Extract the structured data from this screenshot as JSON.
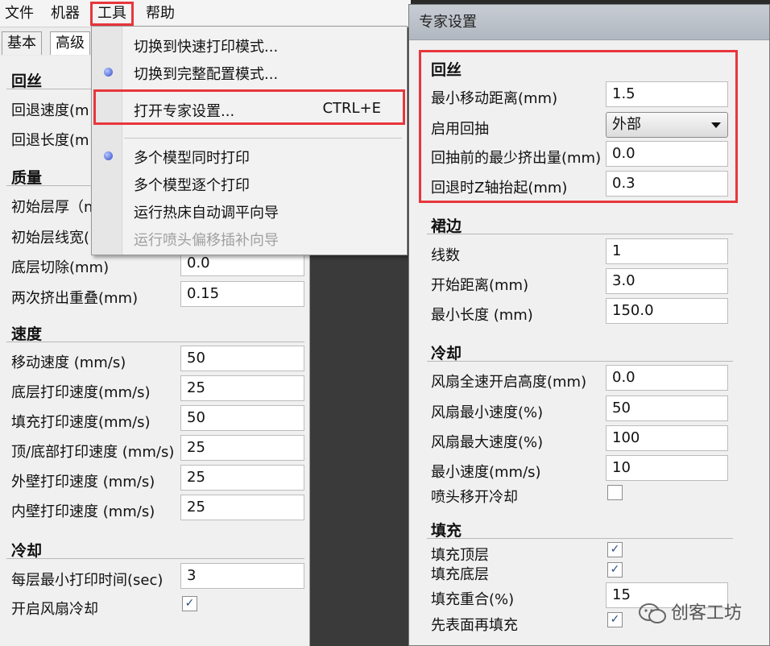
{
  "menubar": {
    "file": "文件",
    "machine": "机器",
    "tools": "工具",
    "help": "帮助"
  },
  "tabs": {
    "basic": "基本",
    "advanced": "高级"
  },
  "left": {
    "retraction": {
      "title": "回丝",
      "speed_label": "回退速度(m",
      "length_label": "回退长度(m"
    },
    "quality": {
      "title": "质量",
      "initial_layer_label": "初始层厚（n",
      "initial_width_label": "初始层线宽(",
      "cut_off_label": "底层切除(mm)",
      "cut_off_value": "0.0",
      "overlap_label": "两次挤出重叠(mm)",
      "overlap_value": "0.15"
    },
    "speed": {
      "title": "速度",
      "rows": [
        {
          "label": "移动速度 (mm/s)",
          "value": "50"
        },
        {
          "label": "底层打印速度(mm/s)",
          "value": "25"
        },
        {
          "label": "填充打印速度(mm/s)",
          "value": "50"
        },
        {
          "label": "顶/底部打印速度 (mm/s)",
          "value": "25"
        },
        {
          "label": "外壁打印速度 (mm/s)",
          "value": "25"
        },
        {
          "label": "内壁打印速度 (mm/s)",
          "value": "25"
        }
      ]
    },
    "cooling": {
      "title": "冷却",
      "min_time_label": "每层最小打印时间(sec)",
      "min_time_value": "3",
      "fan_label": "开启风扇冷却",
      "fan_checked": true
    }
  },
  "dropdown": {
    "quick_mode": "切换到快速打印模式...",
    "full_mode": "切换到完整配置模式...",
    "expert": "打开专家设置...",
    "expert_shortcut": "CTRL+E",
    "multi_same": "多个模型同时打印",
    "multi_one": "多个模型逐个打印",
    "bed_level": "运行热床自动调平向导",
    "nozzle_offset": "运行喷头偏移插补向导"
  },
  "dialog": {
    "title": "专家设置",
    "retraction": {
      "title": "回丝",
      "min_travel_label": "最小移动距离(mm)",
      "min_travel_value": "1.5",
      "enable_label": "启用回抽",
      "enable_value": "外部",
      "min_extrusion_label": "回抽前的最少挤出量(mm)",
      "min_extrusion_value": "0.0",
      "z_hop_label": "回退时Z轴抬起(mm)",
      "z_hop_value": "0.3"
    },
    "skirt": {
      "title": "裙边",
      "lines_label": "线数",
      "lines_value": "1",
      "start_label": "开始距离(mm)",
      "start_value": "3.0",
      "min_len_label": "最小长度 (mm)",
      "min_len_value": "150.0"
    },
    "cooling": {
      "title": "冷却",
      "full_height_label": "风扇全速开启高度(mm)",
      "full_height_value": "0.0",
      "fan_min_label": "风扇最小速度(%)",
      "fan_min_value": "50",
      "fan_max_label": "风扇最大速度(%)",
      "fan_max_value": "100",
      "min_speed_label": "最小速度(mm/s)",
      "min_speed_value": "10",
      "head_lift_label": "喷头移开冷却",
      "head_lift_checked": false
    },
    "infill": {
      "title": "填充",
      "top_label": "填充顶层",
      "top_checked": true,
      "bottom_label": "填充底层",
      "bottom_checked": true,
      "overlap_label": "填充重合(%)",
      "overlap_value": "15",
      "perimeter_first_label": "先表面再填充",
      "perimeter_first_checked": true
    }
  },
  "watermark": "创客工坊",
  "colors": {
    "highlight": "#e8363c",
    "radio": "#2f4ac8"
  }
}
